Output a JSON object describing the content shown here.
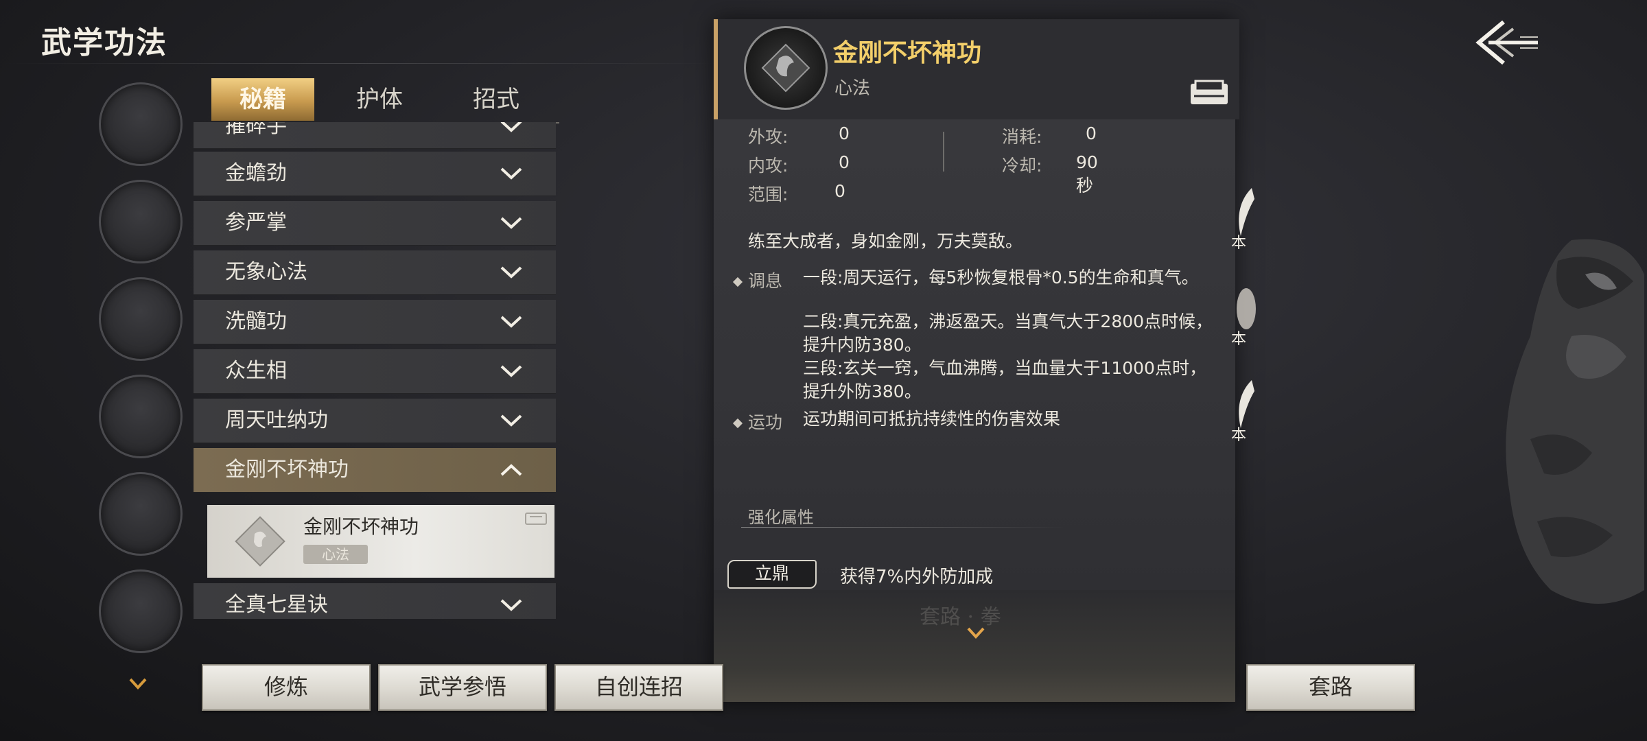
{
  "header": {
    "title": "武学功法"
  },
  "tabs": [
    {
      "label": "秘籍",
      "active": true
    },
    {
      "label": "护体",
      "active": false
    },
    {
      "label": "招式",
      "active": false
    }
  ],
  "skill_list": {
    "partial_top": "摧碎手",
    "items": [
      {
        "label": "金蟾劲"
      },
      {
        "label": "参严掌"
      },
      {
        "label": "无象心法"
      },
      {
        "label": "洗髓功"
      },
      {
        "label": "众生相"
      },
      {
        "label": "周天吐纳功"
      },
      {
        "label": "金刚不坏神功",
        "expanded": true
      },
      {
        "label": "全真七星诀"
      }
    ],
    "sub_item": {
      "name": "金刚不坏神功",
      "tag": "心法"
    }
  },
  "detail": {
    "name": "金刚不坏神功",
    "type": "心法",
    "stats": {
      "external_attack": {
        "label": "外攻:",
        "value": "0"
      },
      "internal_attack": {
        "label": "内攻:",
        "value": "0"
      },
      "range": {
        "label": "范围:",
        "value": "0"
      },
      "cost": {
        "label": "消耗:",
        "value": "0"
      },
      "cooldown": {
        "label": "冷却:",
        "value": "90秒"
      }
    },
    "description": "练至大成者，身如金刚，万夫莫敌。",
    "sections": [
      {
        "key": "调息",
        "lines": [
          "一段:周天运行，每5秒恢复根骨*0.5的生命和真气。",
          "",
          "二段:真元充盈，沸返盈天。当真气大于2800点时候，提升内防380。",
          "三段:玄关一窍，气血沸腾，当血量大于11000点时，提升外防380。"
        ]
      },
      {
        "key": "运功",
        "lines": [
          "运功期间可抵抗持续性的伤害效果"
        ]
      }
    ],
    "enhance": {
      "title": "强化属性",
      "badge": "立鼎",
      "text": "获得7%内外防加成"
    },
    "footer_ghost": "套路 · 拳"
  },
  "buttons": {
    "cultivate": "修炼",
    "comprehend": "武学参悟",
    "custom_combo": "自创连招",
    "routine": "套路"
  },
  "side": {
    "pet_label": "本"
  },
  "colors": {
    "accent_gold": "#f3cf6a",
    "tab_active": "#d8ae63",
    "row_active": "#7c6c52"
  }
}
